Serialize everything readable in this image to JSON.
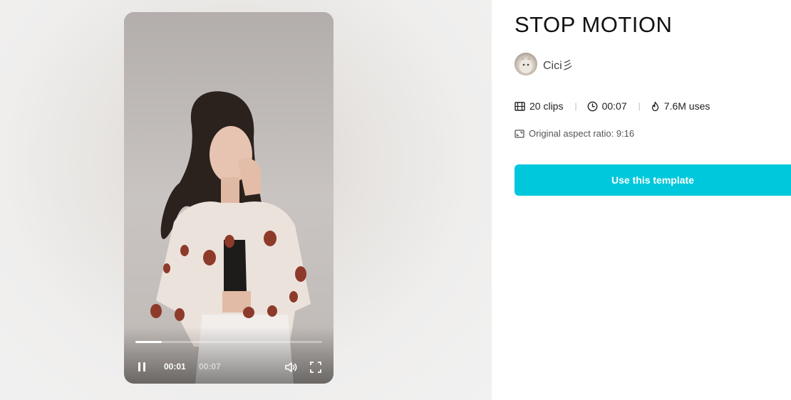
{
  "player": {
    "current_time": "00:01",
    "total_time": "00:07",
    "progress_fraction": 0.14,
    "pause_icon": "pause-icon",
    "volume_icon": "volume-icon",
    "fullscreen_icon": "fullscreen-icon"
  },
  "template": {
    "title": "STOP MOTION",
    "author": "Cici彡",
    "stats": {
      "clips": "20 clips",
      "duration": "00:07",
      "uses": "7.6M uses"
    },
    "aspect_ratio": "Original aspect ratio: 9:16",
    "cta_label": "Use this template"
  },
  "colors": {
    "accent": "#00c8dc",
    "background": "#ffffff",
    "preview_backdrop": "#efeeed"
  }
}
